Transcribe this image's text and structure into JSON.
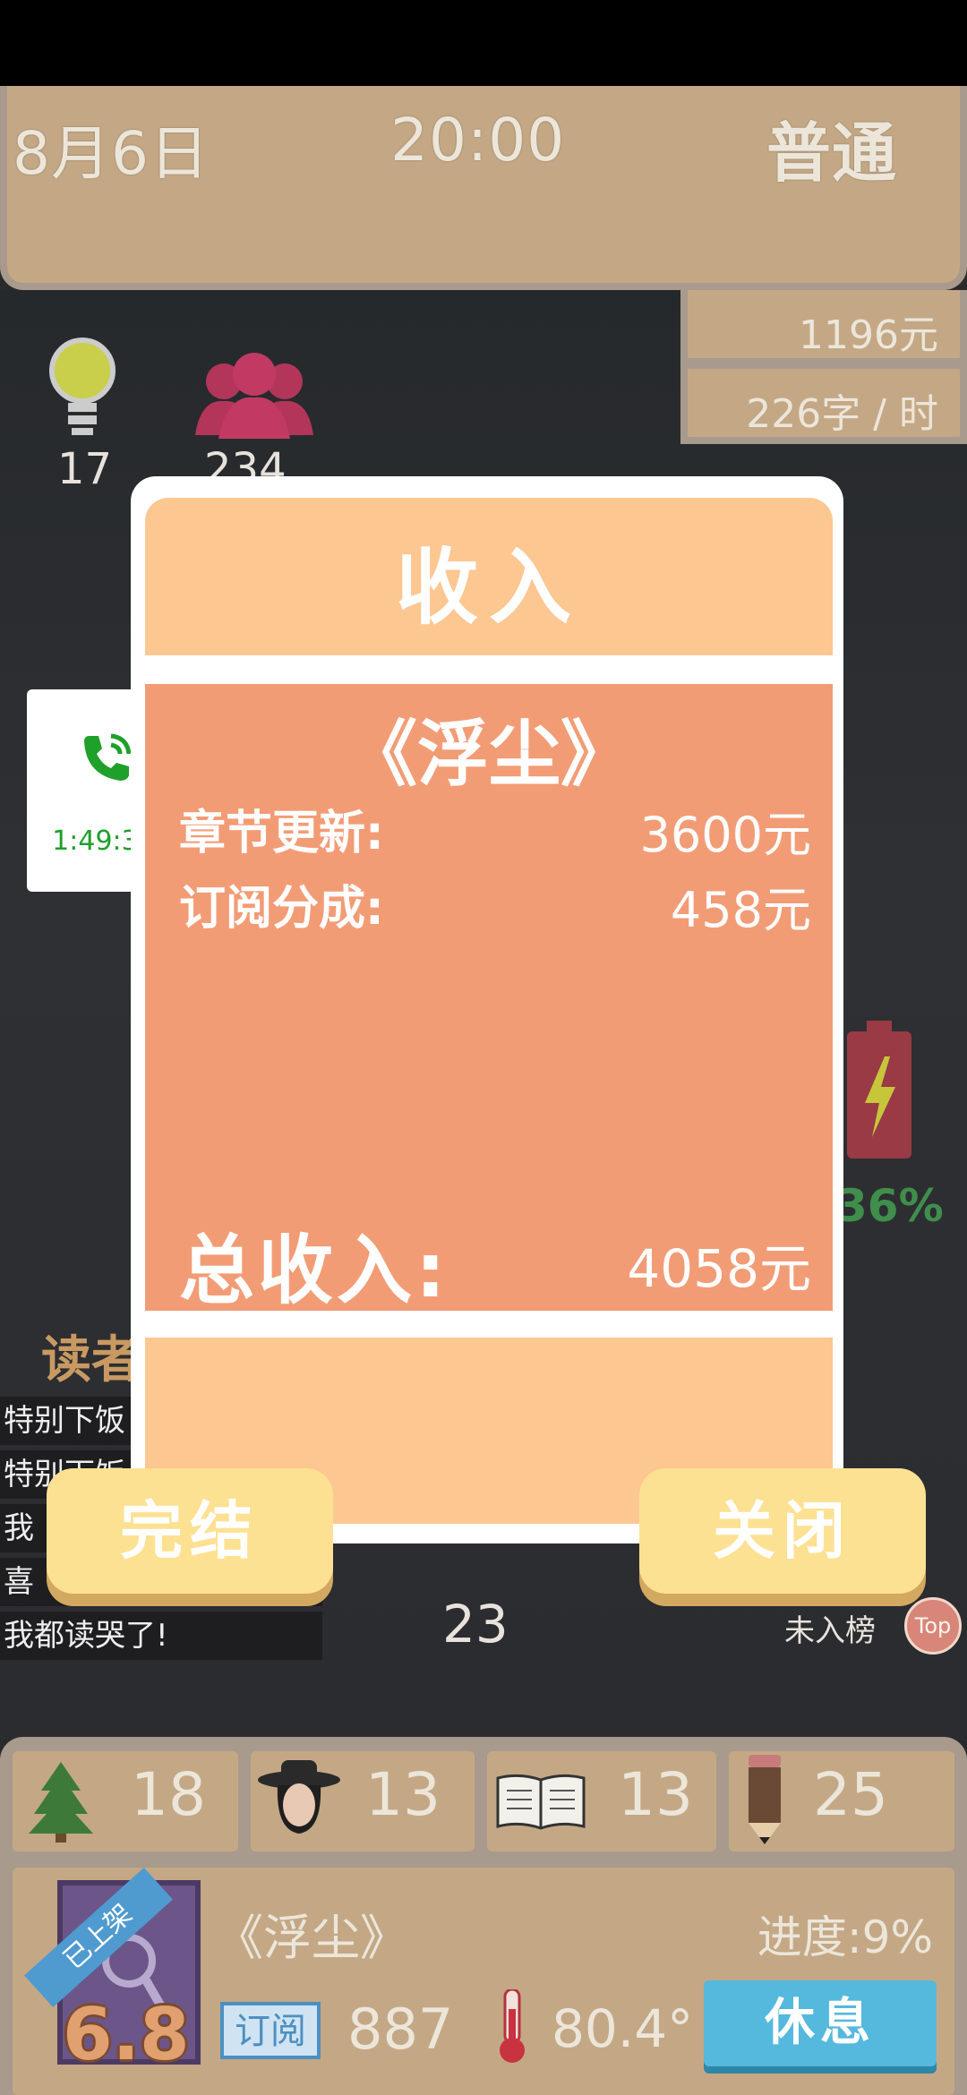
{
  "header": {
    "date": "8月6日",
    "time": "20:00",
    "difficulty": "普通",
    "money": "1196元",
    "speed": "226字 / 时"
  },
  "stats_left": {
    "ideas": "17",
    "fans": "234"
  },
  "call": {
    "duration": "1:49:32"
  },
  "battery": {
    "percent": "36%"
  },
  "readers": {
    "title": "读者",
    "comments": [
      "特别下饭",
      "特别下饭",
      "我",
      "喜",
      "我都读哭了!"
    ]
  },
  "pen_count": "23",
  "rank": {
    "label": "未入榜",
    "badge": "Top"
  },
  "modal": {
    "title": "收入",
    "book": "《浮尘》",
    "rows": [
      {
        "label": "章节更新:",
        "value": "3600元"
      },
      {
        "label": "订阅分成:",
        "value": "458元"
      }
    ],
    "total_label": "总收入:",
    "total_value": "4058元",
    "finish_button": "完结",
    "close_button": "关闭"
  },
  "bottom_stats": {
    "tree": "18",
    "character": "13",
    "book": "13",
    "pencil": "25"
  },
  "book_panel": {
    "ribbon": "已上架",
    "score": "6.8",
    "title": "《浮尘》",
    "progress": "进度:9%",
    "subscribe_tag": "订阅",
    "subscribers": "887",
    "heat": "80.4°",
    "rest_button": "休息"
  }
}
